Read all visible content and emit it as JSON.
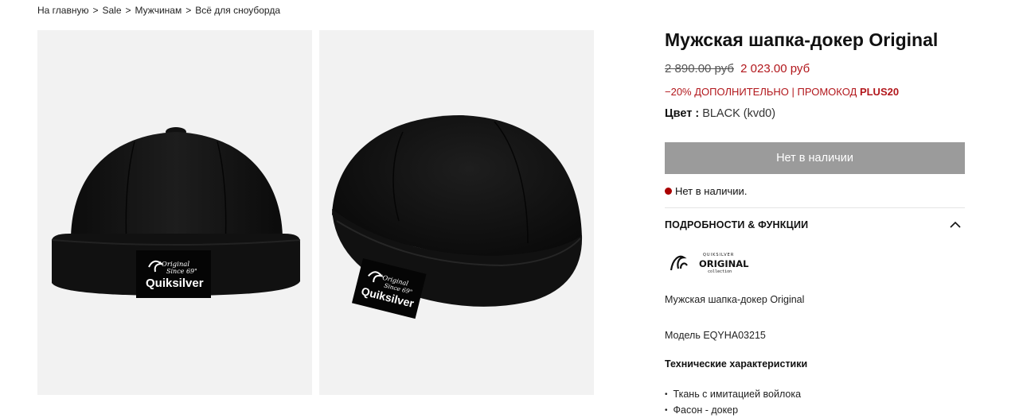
{
  "breadcrumb": {
    "items": [
      "На главную",
      "Sale",
      "Мужчинам",
      "Всё для сноуборда"
    ],
    "separator": ">"
  },
  "gallery": {
    "images": [
      {
        "label_line1": "\"Original",
        "label_line2": "Since 69\"",
        "brand": "Quiksilver"
      },
      {
        "label_line1": "\"Original",
        "label_line2": "Since 69\"",
        "brand": "Quiksilver"
      }
    ]
  },
  "product": {
    "title": "Мужская шапка-докер Original",
    "price_old": "2 890.00 руб",
    "price_new": "2 023.00 руб",
    "promo_text": "−20% ДОПОЛНИТЕЛЬНО | ПРОМОКОД ",
    "promo_code": "PLUS20",
    "color_label": "Цвет :",
    "color_value": "BLACK (kvd0)",
    "stock_button": "Нет в наличии",
    "stock_status": "Нет в наличии.",
    "section_title": "ПОДРОБНОСТИ & ФУНКЦИИ",
    "logo": {
      "top": "QUIKSILVER",
      "main": "ORIGINALS",
      "sub": "collection"
    },
    "description": "Мужская шапка-докер Original",
    "model": "Модель EQYHA03215",
    "specs_title": "Технические характеристики",
    "specs": [
      "Ткань с имитацией войлока",
      "Фасон - докер"
    ]
  },
  "colors": {
    "sale": "#b2171c",
    "button_disabled": "#9b9b9b",
    "status_dot": "#aa0000",
    "image_bg": "#f2f2f2"
  }
}
